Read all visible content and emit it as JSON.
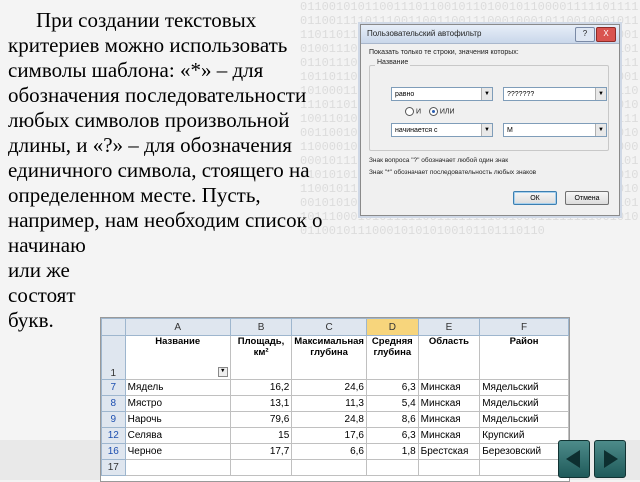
{
  "slide": {
    "paragraph": "При создании текстовых критериев можно использовать символы шаблона: «*» – для обозначения последовательности любых символов произвольной длины, и «?» – для обозначения единичного символа, стоящего на определенном месте. Пусть, например, нам необходим список о",
    "lines_tail": [
      "начинаю",
      "или же",
      "состоят",
      "букв."
    ]
  },
  "dialog": {
    "title": "Пользовательский автофильтр",
    "show_label": "Показать только те строки, значения которых:",
    "group_label": "Название",
    "cond1_op": "равно",
    "cond1_value": "???????",
    "radio_and": "И",
    "radio_or": "ИЛИ",
    "cond2_op": "начинается с",
    "cond2_value": "М",
    "hint1": "Знак вопроса \"?\" обозначает любой один знак",
    "hint2": "Знак \"*\" обозначает последовательность любых знаков",
    "ok_label": "ОК",
    "cancel_label": "Отмена",
    "help_label": "?",
    "close_label": "X"
  },
  "excel": {
    "col_headers": [
      "",
      "A",
      "B",
      "C",
      "D",
      "E",
      "F"
    ],
    "header_row": {
      "num": "1",
      "cells": [
        "Название",
        "Площадь, км²",
        "Максимальная глубина",
        "Средняя глубина",
        "Область",
        "Район"
      ]
    },
    "rows": [
      {
        "num": "7",
        "cells": [
          "Мядель",
          "16,2",
          "24,6",
          "6,3",
          "Минская",
          "Мядельский"
        ]
      },
      {
        "num": "8",
        "cells": [
          "Мястро",
          "13,1",
          "11,3",
          "5,4",
          "Минская",
          "Мядельский"
        ]
      },
      {
        "num": "9",
        "cells": [
          "Нарочь",
          "79,6",
          "24,8",
          "8,6",
          "Минская",
          "Мядельский"
        ]
      },
      {
        "num": "12",
        "cells": [
          "Селява",
          "15",
          "17,6",
          "6,3",
          "Минская",
          "Крупский"
        ]
      },
      {
        "num": "16",
        "cells": [
          "Черное",
          "17,7",
          "6,6",
          "1,8",
          "Брестская",
          "Березовский"
        ]
      },
      {
        "num": "17",
        "cells": [
          "",
          "",
          "",
          "",
          "",
          ""
        ]
      }
    ]
  },
  "background_binary": "011001010110011101100101101001011000011111011110110011110111001100110011100010001011001000101111011011101001010101011001101010101101100111001010011101010001011110110101011001101001011101010110111001010011100101101110111011111010010111110110110101011101111011101011110110001010111001101000110111010101110101101001111001101111001101110110101010101111010101001110110010011011101010011010100111001101101101001101111010111000111001100100010111100110101001100110101111010110101100001010010010111011110110101010110001111000000010111000010110001010111100010101001011101101010101011110001110111011111011111100110001100101100101100101111001101101101110101101001010001000101010001010110110101110011110110001010101101101110001010111110011111111001000111111110010100110010111000101010100101101110110"
}
